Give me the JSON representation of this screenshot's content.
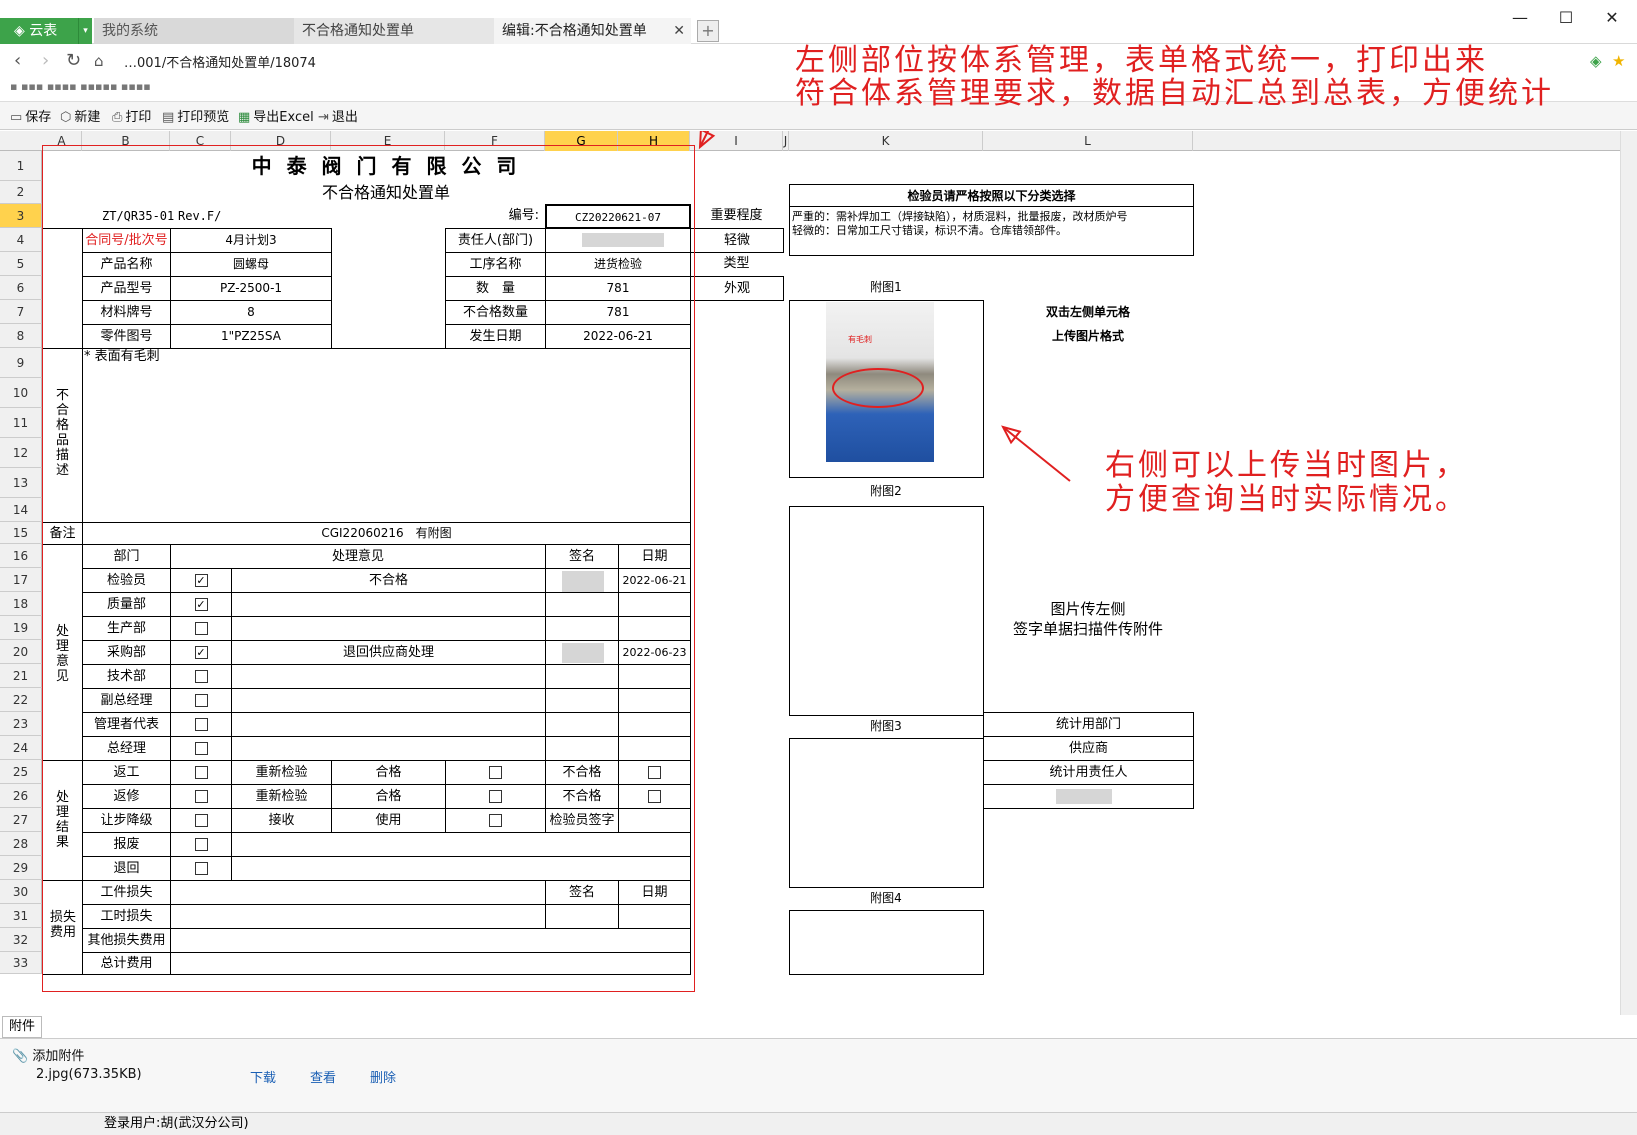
{
  "tabs": {
    "app": "云表",
    "system": "我的系统",
    "ncr": "不合格通知处置单",
    "edit": "编辑:不合格通知处置单"
  },
  "url": "…001/不合格通知处置单/18074",
  "annotations": {
    "top_line1": "左侧部位按体系管理，表单格式统一，打印出来",
    "top_line2": "符合体系管理要求，数据自动汇总到总表，方便统计",
    "right_line1": "右侧可以上传当时图片，",
    "right_line2": "方便查询当时实际情况。"
  },
  "toolbar": {
    "save": "保存",
    "new": "新建",
    "print": "打印",
    "preview": "打印预览",
    "export": "导出Excel",
    "exit": "退出"
  },
  "columns": [
    "A",
    "B",
    "C",
    "D",
    "E",
    "F",
    "G",
    "H",
    "I",
    "J",
    "K",
    "L"
  ],
  "rows": [
    "1",
    "2",
    "3",
    "4",
    "5",
    "6",
    "7",
    "8",
    "9",
    "10",
    "11",
    "12",
    "13",
    "14",
    "15",
    "16",
    "17",
    "18",
    "19",
    "20",
    "21",
    "22",
    "23",
    "24",
    "25",
    "26",
    "27",
    "28",
    "29",
    "30",
    "31",
    "32",
    "33"
  ],
  "form": {
    "company": "中 泰 阀 门 有 限 公 司",
    "title": "不合格通知处置单",
    "doc_no": "ZT/QR35-01",
    "rev": "Rev.F/",
    "serial_label": "编号:",
    "serial": "CZ20220621-07",
    "contract_label": "合同号/批次号",
    "contract": "4月计划3",
    "owner_label": "责任人(部门)",
    "product_label": "产品名称",
    "product": "圆螺母",
    "process_label": "工序名称",
    "process": "进货检验",
    "model_label": "产品型号",
    "model": "PZ-2500-1",
    "qty_label": "数　量",
    "qty": "781",
    "material_label": "材料牌号",
    "material": "8",
    "ncqty_label": "不合格数量",
    "ncqty": "781",
    "part_label": "零件图号",
    "part": "1\"PZ25SA",
    "date_label": "发生日期",
    "date": "2022-06-21",
    "desc_label": "不合格品描述",
    "desc": "* 表面有毛刺",
    "remark_label": "备注",
    "remark": "CGI22060216　有附图",
    "opinion_label": "处理意见",
    "op_header": {
      "dept": "部门",
      "opinion": "处理意见",
      "sign": "签名",
      "date": "日期"
    },
    "op_rows": [
      {
        "dept": "检验员",
        "checked": true,
        "opinion": "不合格",
        "date": "2022-06-21"
      },
      {
        "dept": "质量部",
        "checked": true,
        "opinion": "",
        "date": ""
      },
      {
        "dept": "生产部",
        "checked": false,
        "opinion": "",
        "date": ""
      },
      {
        "dept": "采购部",
        "checked": true,
        "opinion": "退回供应商处理",
        "date": "2022-06-23"
      },
      {
        "dept": "技术部",
        "checked": false,
        "opinion": "",
        "date": ""
      },
      {
        "dept": "副总经理",
        "checked": false,
        "opinion": "",
        "date": ""
      },
      {
        "dept": "管理者代表",
        "checked": false,
        "opinion": "",
        "date": ""
      },
      {
        "dept": "总经理",
        "checked": false,
        "opinion": "",
        "date": ""
      }
    ],
    "result_label": "处理结果",
    "res_rows": [
      {
        "label": "返工",
        "d": "重新检验",
        "e": "合格",
        "g": "不合格"
      },
      {
        "label": "返修",
        "d": "重新检验",
        "e": "合格",
        "g": "不合格"
      },
      {
        "label": "让步降级",
        "d": "接收",
        "e": "使用",
        "g": "检验员签字"
      },
      {
        "label": "报废",
        "d": "",
        "e": "",
        "g": ""
      },
      {
        "label": "退回",
        "d": "",
        "e": "",
        "g": ""
      }
    ],
    "loss_label": "损失费用",
    "loss_rows": [
      "工件损失",
      "工时损失",
      "其他损失费用",
      "总计费用"
    ],
    "loss_sign": "签名",
    "loss_date": "日期"
  },
  "side": {
    "importance": "重要程度",
    "light": "轻微",
    "type_label": "类型",
    "type": "外观",
    "guide_title": "检验员请严格按照以下分类选择",
    "guide_line1": "严重的：需补焊加工（焊接缺陷），材质混料，批量报废，改材质炉号",
    "guide_line2": "轻微的：日常加工尺寸错误，标识不清。仓库错领部件。",
    "att1": "附图1",
    "att2": "附图2",
    "att3": "附图3",
    "att4": "附图4",
    "hint1": "双击左侧单元格",
    "hint2": "上传图片格式",
    "hint3": "图片传左侧",
    "hint4": "签字单据扫描件传附件",
    "photo_tag": "有毛刺",
    "stats": [
      "统计用部门",
      "供应商",
      "统计用责任人"
    ]
  },
  "attach": {
    "tab": "附件",
    "add": "添加附件",
    "file": "2.jpg(673.35KB)",
    "download": "下载",
    "view": "查看",
    "delete": "删除"
  },
  "status": {
    "user": "登录用户:胡(武汉分公司)"
  },
  "colors": {
    "accent": "#3da34a",
    "annotation": "#e02020",
    "selected": "#ffd24d"
  }
}
